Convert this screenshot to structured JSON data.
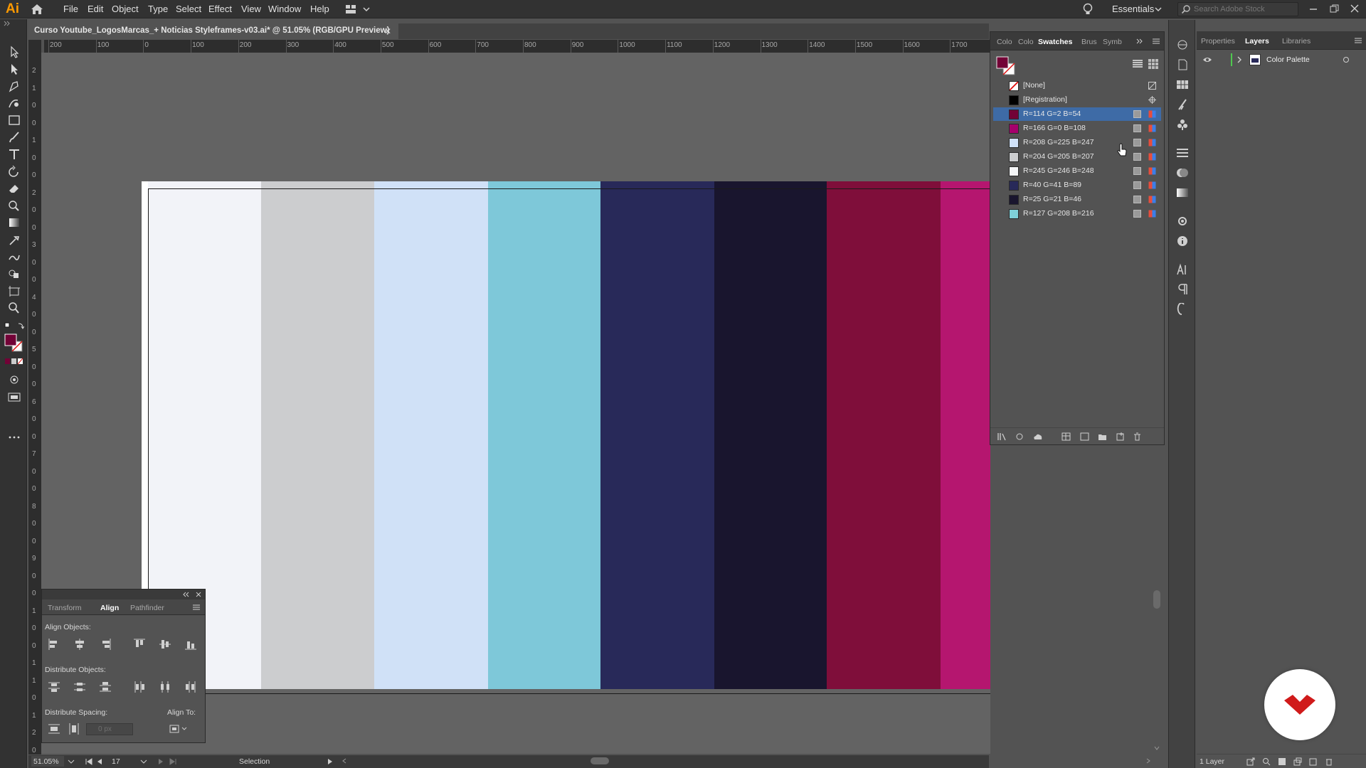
{
  "app": {
    "logo": "Ai",
    "workspace": "Essentials",
    "search_placeholder": "Search Adobe Stock"
  },
  "menu": [
    "File",
    "Edit",
    "Object",
    "Type",
    "Select",
    "Effect",
    "View",
    "Window",
    "Help"
  ],
  "document": {
    "tab_title": "Curso Youtube_LogosMarcas_+ Noticias Styleframes-v03.ai* @ 51.05% (RGB/GPU Preview)"
  },
  "rulers": {
    "top": [
      "200",
      "100",
      "0",
      "100",
      "200",
      "300",
      "400",
      "500",
      "600",
      "700",
      "800",
      "900",
      "1000",
      "1100",
      "1200",
      "1300",
      "1400",
      "1500",
      "1600",
      "1700",
      "1"
    ],
    "left": [
      "2",
      "1",
      "0",
      "0",
      "1",
      "0",
      "0",
      "2",
      "0",
      "0",
      "3",
      "0",
      "0",
      "4",
      "0",
      "0",
      "5",
      "0",
      "0",
      "6",
      "0",
      "0",
      "7",
      "0",
      "0",
      "8",
      "0",
      "0",
      "9",
      "0",
      "0",
      "1",
      "0",
      "0",
      "1",
      "1",
      "0",
      "1",
      "2",
      "0"
    ]
  },
  "artboard": {
    "stripes": [
      "#f2f3f8",
      "#cccdcf",
      "#d0e1f7",
      "#7ec8d9",
      "#282959",
      "#19152e",
      "#7f0e3a",
      "#b5166f"
    ]
  },
  "swatches": {
    "tabs": [
      "Colo",
      "Colo",
      "Swatches",
      "Brus",
      "Symb"
    ],
    "items": [
      {
        "label": "[None]",
        "color": "none"
      },
      {
        "label": "[Registration]",
        "color": "#000000"
      },
      {
        "label": "R=114 G=2 B=54",
        "color": "#720236",
        "selected": true
      },
      {
        "label": "R=166 G=0 B=108",
        "color": "#a6006c"
      },
      {
        "label": "R=208 G=225 B=247",
        "color": "#d0e1f7"
      },
      {
        "label": "R=204 G=205 B=207",
        "color": "#cccdcf"
      },
      {
        "label": "R=245 G=246 B=248",
        "color": "#f5f6f8"
      },
      {
        "label": "R=40 G=41 B=89",
        "color": "#282959"
      },
      {
        "label": "R=25 G=21 B=46",
        "color": "#19152e"
      },
      {
        "label": "R=127 G=208 B=216",
        "color": "#7fd0d8"
      }
    ]
  },
  "layers": {
    "tabs": [
      "Properties",
      "Layers",
      "Libraries"
    ],
    "items": [
      {
        "name": "Color Palette"
      }
    ],
    "footer": "1 Layer"
  },
  "align": {
    "tabs": [
      "Transform",
      "Align",
      "Pathfinder"
    ],
    "align_objects": "Align Objects:",
    "distribute_objects": "Distribute Objects:",
    "distribute_spacing": "Distribute Spacing:",
    "align_to": "Align To:",
    "spacing_value": "0 px"
  },
  "status": {
    "zoom": "51.05%",
    "artboard": "17",
    "tool": "Selection"
  },
  "colors": {
    "fill": "#720236",
    "accent_orange": "#ff9a00",
    "selection_blue": "#3e6ba6",
    "badge_red": "#d01a1a"
  }
}
